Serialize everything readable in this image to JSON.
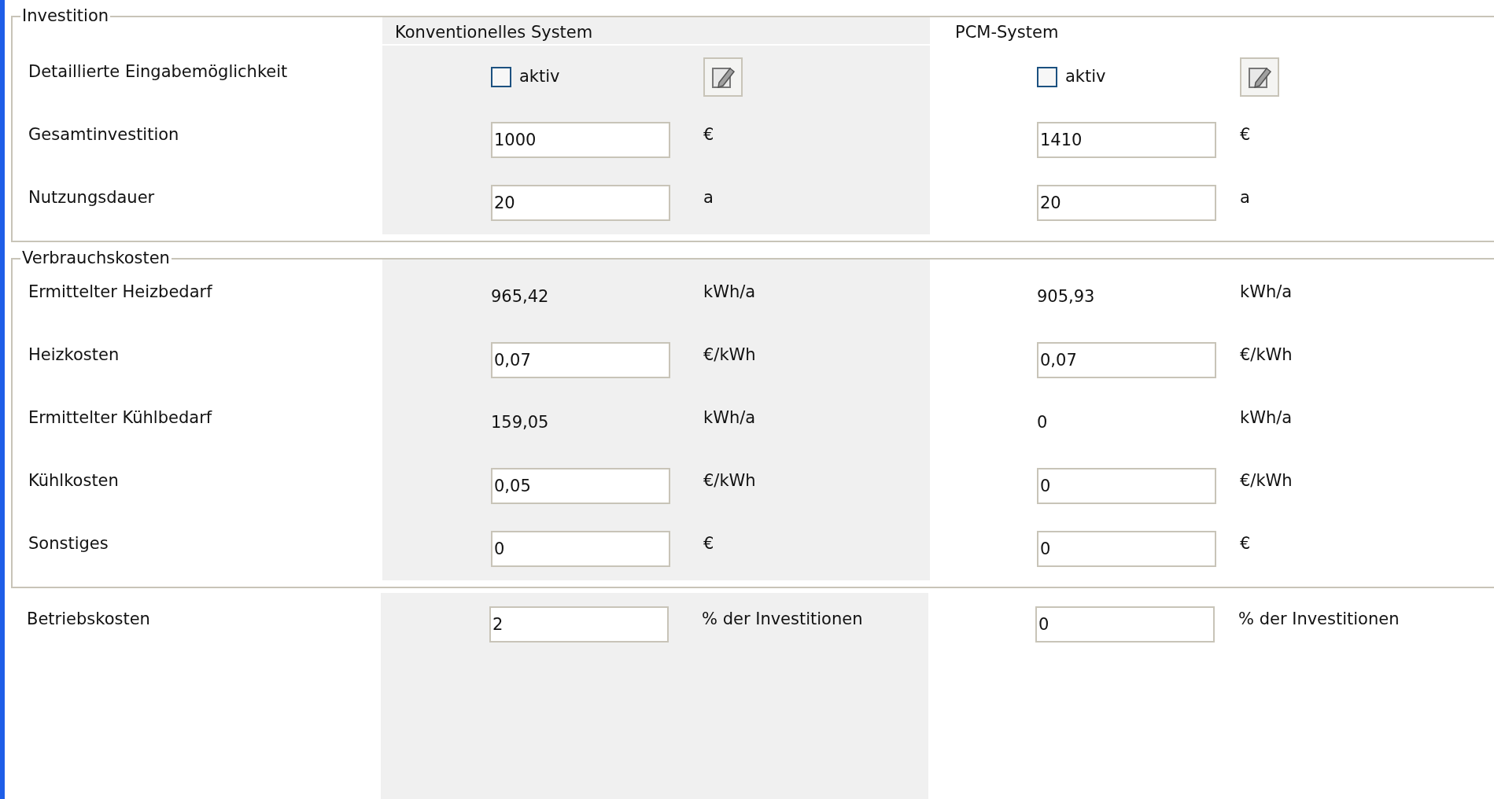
{
  "columns": [
    "Konventionelles System",
    "PCM-System"
  ],
  "sections": [
    {
      "legend": "Investition",
      "rows": [
        {
          "kind": "checkbox",
          "label": "Detaillierte Eingabemöglichkeit",
          "cells": [
            {
              "text": "aktiv",
              "checked": false
            },
            {
              "text": "aktiv",
              "checked": false
            }
          ]
        },
        {
          "kind": "input",
          "label": "Gesamtinvestition",
          "cells": [
            {
              "value": "1000",
              "unit": "€"
            },
            {
              "value": "1410",
              "unit": "€"
            }
          ]
        },
        {
          "kind": "input",
          "label": "Nutzungsdauer",
          "cells": [
            {
              "value": "20",
              "unit": "a"
            },
            {
              "value": "20",
              "unit": "a"
            }
          ]
        }
      ]
    },
    {
      "legend": "Verbrauchskosten",
      "rows": [
        {
          "kind": "value",
          "label": "Ermittelter Heizbedarf",
          "cells": [
            {
              "value": "965,42",
              "unit": "kWh/a"
            },
            {
              "value": "905,93",
              "unit": "kWh/a"
            }
          ]
        },
        {
          "kind": "input",
          "label": "Heizkosten",
          "cells": [
            {
              "value": "0,07",
              "unit": "€/kWh"
            },
            {
              "value": "0,07",
              "unit": "€/kWh"
            }
          ]
        },
        {
          "kind": "value",
          "label": "Ermittelter Kühlbedarf",
          "cells": [
            {
              "value": "159,05",
              "unit": "kWh/a"
            },
            {
              "value": "0",
              "unit": "kWh/a"
            }
          ]
        },
        {
          "kind": "input",
          "label": "Kühlkosten",
          "cells": [
            {
              "value": "0,05",
              "unit": "€/kWh"
            },
            {
              "value": "0",
              "unit": "€/kWh"
            }
          ]
        },
        {
          "kind": "input",
          "label": "Sonstiges",
          "cells": [
            {
              "value": "0",
              "unit": "€"
            },
            {
              "value": "0",
              "unit": "€"
            }
          ]
        }
      ]
    },
    {
      "rows": [
        {
          "kind": "input",
          "label": "Betriebskosten",
          "cells": [
            {
              "value": "2",
              "unit": "% der Investitionen"
            },
            {
              "value": "0",
              "unit": "% der Investitionen"
            }
          ]
        }
      ]
    }
  ]
}
